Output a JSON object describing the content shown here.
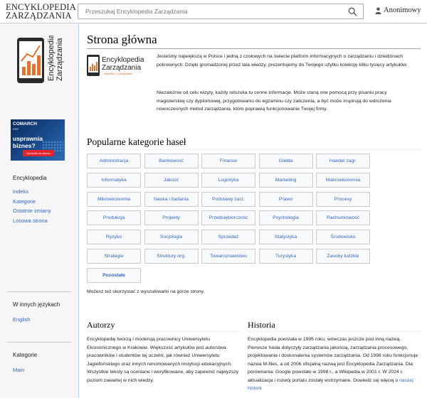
{
  "header": {
    "logo_line1": "ENCYKLOPEDIA",
    "logo_line2": "ZARZĄDZANIA",
    "search_placeholder": "Przeszukaj Encyklopedia Zarządzania",
    "user_label": "Anonimowy"
  },
  "sidebar": {
    "logo_text_top": "Encyklopedia",
    "logo_text_bottom": "Zarządzania",
    "ad": {
      "brand": "COMARCH",
      "sub": "ERP",
      "headline": "usprawnia biznes?",
      "cta": "Sprawdź za darmo"
    },
    "nav": {
      "heading": "Encyklopedia",
      "items": [
        "Indeks",
        "Kategorie",
        "Ostatnie zmiany",
        "Losowa strona"
      ]
    },
    "languages": {
      "heading": "W innych językach",
      "items": [
        "English"
      ]
    },
    "categories": {
      "heading": "Kategorie",
      "items": [
        "Main"
      ]
    }
  },
  "main": {
    "title": "Strona główna",
    "intro_logo_title": "Encyklopedia",
    "intro_logo_subtitle": "Zarządzania",
    "intro_logo_tagline": "wszystko o zarządzaniu",
    "intro_p1": "Jesteśmy największą w Polsce i jedną z czołowych na świecie platform informacyjnych o zarządzaniu i dziedzinach pokrewnych. Dzięki gromadzonej przez lata wiedzy, prezentujemy do Twojego użytku kolekcję kilku tysięcy artykułów.",
    "intro_p2": "Niezależnie od celu wizyty, każdy odszuka tu cenne informacje. Może staną one pomocą przy pisaniu pracy magisterskiej czy dyplomowej, przygotowaniu do egzaminu czy zaliczenia, a być może inspirują do wdrożenia nowoczesnych metod zarządzania, które poprawią funkcjonowanie Twojej firmy.",
    "categories_heading": "Popularne kategorie haseł",
    "categories": [
      "Administracja",
      "Bankowość",
      "Finanse",
      "Giełda",
      "Handel zagr.",
      "Informatyka",
      "Jakość",
      "Logistyka",
      "Marketing",
      "Makroekonomia",
      "Mikroekonomia",
      "Nauka i badania",
      "Podstawy zarz.",
      "Prawo",
      "Procesy",
      "Produkcja",
      "Projekty",
      "Przedsiębiorczość",
      "Psychologia",
      "Rachunkowość",
      "Ryzyko",
      "Socjologia",
      "Sprzedaż",
      "Statystyka",
      "Środowisko",
      "Strategie",
      "Struktury org.",
      "Towaroznawstwo",
      "Turystyka",
      "Zasoby ludzkie",
      "Pozostałe"
    ],
    "search_hint": "Możesz też skorzystać z wyszukiwarki na górze strony.",
    "authors_heading": "Autorzy",
    "authors_text": "Encyklopedię tworzą i moderują pracownicy Uniwersytetu Ekonomicznego w Krakowie. Większość artykułów jest autorstwa pracowników i studentów tej uczelni, jak również Uniwersytetu Jagiellońskiego oraz innych renomowanych instytucji edukacyjnych. Wszystkie teksty są oceniane i weryfikowane, aby zapewnić najwyższy poziom zawartej w nich wiedzy.",
    "history_heading": "Historia",
    "history_text": "Encyklopedia powstała w 1995 roku, wówczas jeszcze pod inną nazwą. Pierwsze hasła dotyczyły zarządzania jakością, zarządzania procesowego, projektowania i doskonalenia systemów zarządzania. Od 1998 roku funkcjonuje nazwa M-files, a od 2006 oficjalną nazwą jest Encyklopedia Zarządzania. Dla porównania: Google powstało w 1998 r., a Wikipedia w 2001 r. W 2024 r. aktualizacja i rozwój portalu zostały wstrzymane. Dowiedz się więcej o",
    "history_link": "naszej historii"
  },
  "colors": {
    "link": "#3366cc",
    "ad_background": "#1a4d8f",
    "ad_cta": "#e3242b",
    "logo_accent": "#e8712b"
  }
}
